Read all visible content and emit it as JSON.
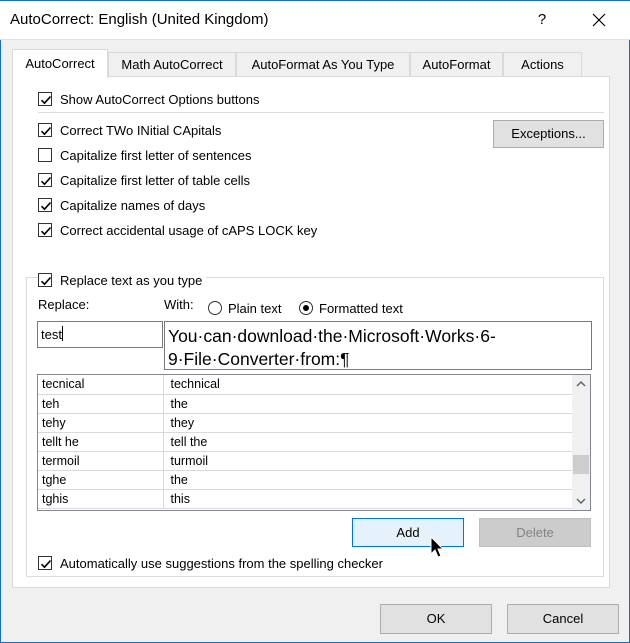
{
  "window": {
    "title": "AutoCorrect: English (United Kingdom)",
    "help": "?",
    "close": "✕"
  },
  "tabs": [
    "AutoCorrect",
    "Math AutoCorrect",
    "AutoFormat As You Type",
    "AutoFormat",
    "Actions"
  ],
  "options": {
    "show_buttons": {
      "label": "Show AutoCorrect Options buttons",
      "checked": true
    },
    "two_initials": {
      "label": "Correct TWo INitial CApitals",
      "checked": true
    },
    "first_letter_sentences": {
      "label": "Capitalize first letter of sentences",
      "checked": false
    },
    "first_letter_table": {
      "label": "Capitalize first letter of table cells",
      "checked": true
    },
    "names_of_days": {
      "label": "Capitalize names of days",
      "checked": true
    },
    "caps_lock": {
      "label": "Correct accidental usage of cAPS LOCK key",
      "checked": true
    },
    "exceptions_button": "Exceptions..."
  },
  "replace_group": {
    "replace_as_you_type": {
      "label": "Replace text as you type",
      "checked": true
    },
    "replace_label": "Replace:",
    "with_label": "With:",
    "plain_text": "Plain text",
    "formatted_text": "Formatted text",
    "selected_format": "Formatted text",
    "replace_value": "test",
    "with_value": "You·can·download·the·Microsoft·Works·6-9·File·Converter·from:¶",
    "entries": [
      {
        "replace": "tecnical",
        "with": "technical"
      },
      {
        "replace": "teh",
        "with": "the"
      },
      {
        "replace": "tehy",
        "with": "they"
      },
      {
        "replace": "tellt he",
        "with": "tell the"
      },
      {
        "replace": "termoil",
        "with": "turmoil"
      },
      {
        "replace": "tghe",
        "with": "the"
      },
      {
        "replace": "tghis",
        "with": "this"
      }
    ],
    "add_button": "Add",
    "delete_button": "Delete",
    "auto_suggestions": {
      "label": "Automatically use suggestions from the spelling checker",
      "checked": true
    }
  },
  "footer": {
    "ok": "OK",
    "cancel": "Cancel"
  },
  "colors": {
    "accent": "#0078d7",
    "border": "#1c6fbf"
  }
}
